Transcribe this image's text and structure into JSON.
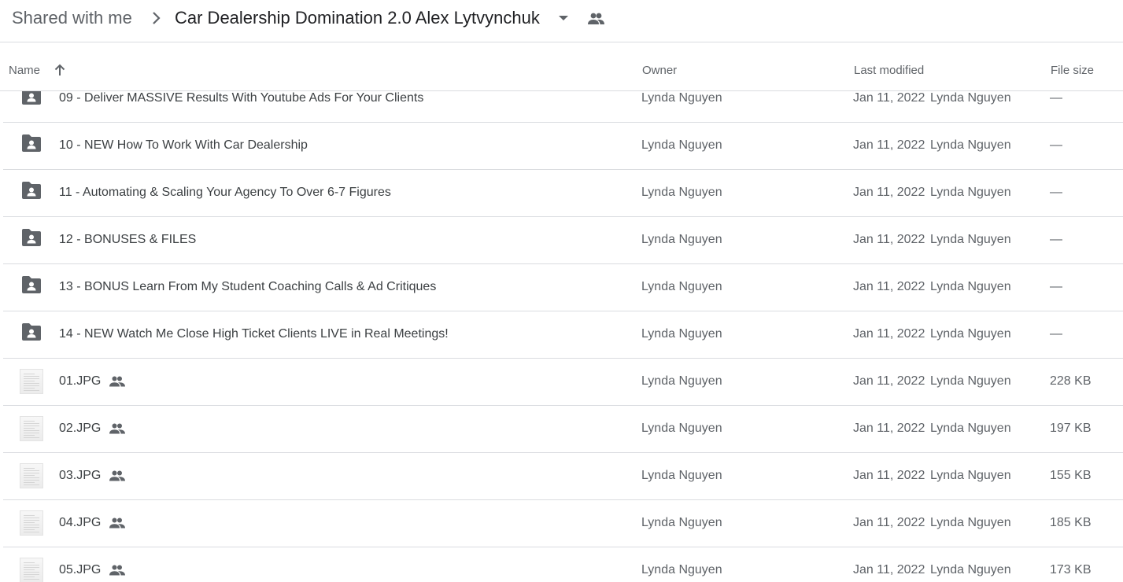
{
  "breadcrumb": {
    "root": "Shared with me",
    "current": "Car Dealership Domination 2.0 Alex Lytvynchuk"
  },
  "columns": {
    "name": "Name",
    "owner": "Owner",
    "last_modified": "Last modified",
    "file_size": "File size"
  },
  "colors": {
    "folder": "#5f6368",
    "text": "#3c4043",
    "secondary": "#5f6368",
    "divider": "#dadce0"
  },
  "rows": [
    {
      "type": "folder",
      "icon": "shared-folder-icon",
      "name": "09 - Deliver MASSIVE Results With Youtube Ads For Your Clients",
      "owner": "Lynda Nguyen",
      "date": "Jan 11, 2022",
      "modifier": "Lynda Nguyen",
      "size": "—"
    },
    {
      "type": "folder",
      "icon": "shared-folder-icon",
      "name": "10 - NEW How To Work With Car Dealership",
      "owner": "Lynda Nguyen",
      "date": "Jan 11, 2022",
      "modifier": "Lynda Nguyen",
      "size": "—"
    },
    {
      "type": "folder",
      "icon": "shared-folder-icon",
      "name": "11 - Automating & Scaling Your Agency To Over 6-7 Figures",
      "owner": "Lynda Nguyen",
      "date": "Jan 11, 2022",
      "modifier": "Lynda Nguyen",
      "size": "—"
    },
    {
      "type": "folder",
      "icon": "shared-folder-icon",
      "name": "12 - BONUSES & FILES",
      "owner": "Lynda Nguyen",
      "date": "Jan 11, 2022",
      "modifier": "Lynda Nguyen",
      "size": "—"
    },
    {
      "type": "folder",
      "icon": "shared-folder-icon",
      "name": "13 - BONUS Learn From My Student Coaching Calls & Ad Critiques",
      "owner": "Lynda Nguyen",
      "date": "Jan 11, 2022",
      "modifier": "Lynda Nguyen",
      "size": "—"
    },
    {
      "type": "folder",
      "icon": "shared-folder-icon",
      "name": "14 - NEW Watch Me Close High Ticket Clients LIVE in Real Meetings!",
      "owner": "Lynda Nguyen",
      "date": "Jan 11, 2022",
      "modifier": "Lynda Nguyen",
      "size": "—"
    },
    {
      "type": "file",
      "icon": "image-thumbnail",
      "name": "01.JPG",
      "shared": true,
      "owner": "Lynda Nguyen",
      "date": "Jan 11, 2022",
      "modifier": "Lynda Nguyen",
      "size": "228 KB"
    },
    {
      "type": "file",
      "icon": "image-thumbnail",
      "name": "02.JPG",
      "shared": true,
      "owner": "Lynda Nguyen",
      "date": "Jan 11, 2022",
      "modifier": "Lynda Nguyen",
      "size": "197 KB"
    },
    {
      "type": "file",
      "icon": "image-thumbnail",
      "name": "03.JPG",
      "shared": true,
      "owner": "Lynda Nguyen",
      "date": "Jan 11, 2022",
      "modifier": "Lynda Nguyen",
      "size": "155 KB"
    },
    {
      "type": "file",
      "icon": "image-thumbnail",
      "name": "04.JPG",
      "shared": true,
      "owner": "Lynda Nguyen",
      "date": "Jan 11, 2022",
      "modifier": "Lynda Nguyen",
      "size": "185 KB"
    },
    {
      "type": "file",
      "icon": "image-thumbnail",
      "name": "05.JPG",
      "shared": true,
      "owner": "Lynda Nguyen",
      "date": "Jan 11, 2022",
      "modifier": "Lynda Nguyen",
      "size": "173 KB"
    }
  ]
}
